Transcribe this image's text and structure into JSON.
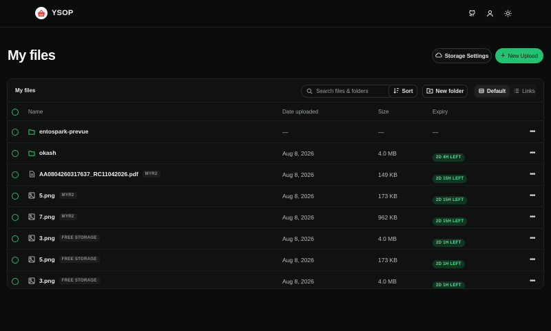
{
  "app": {
    "name": "YSOP"
  },
  "page": {
    "title": "My files"
  },
  "actions": {
    "storage_settings": "Storage Settings",
    "new_upload": "New Upload"
  },
  "panel": {
    "title": "My files",
    "search_placeholder": "Search files & folders",
    "sort_label": "Sort",
    "new_folder_label": "New folder",
    "view_default": "Default",
    "view_links": "Links"
  },
  "columns": {
    "name": "Name",
    "date": "Date uploaded",
    "size": "Size",
    "expiry": "Expiry"
  },
  "rows": [
    {
      "type": "folder",
      "name": "entospark-prevue",
      "tag": "",
      "date": "—",
      "size": "—",
      "expiry": "—"
    },
    {
      "type": "folder",
      "name": "okash",
      "tag": "",
      "date": "Aug 8, 2026",
      "size": "4.0 MB",
      "expiry": "2D 4H LEFT"
    },
    {
      "type": "document",
      "name": "AA0804260317637_RC11042026.pdf",
      "tag": "MYR2",
      "date": "Aug 8, 2026",
      "size": "149 KB",
      "expiry": "2D 15H LEFT"
    },
    {
      "type": "image",
      "name": "5.png",
      "tag": "MYR2",
      "date": "Aug 8, 2026",
      "size": "173 KB",
      "expiry": "2D 15H LEFT"
    },
    {
      "type": "image",
      "name": "7.png",
      "tag": "MYR2",
      "date": "Aug 8, 2026",
      "size": "962 KB",
      "expiry": "2D 15H LEFT"
    },
    {
      "type": "image",
      "name": "3.png",
      "tag": "FREE STORAGE",
      "date": "Aug 8, 2026",
      "size": "4.0 MB",
      "expiry": "2D 1H LEFT"
    },
    {
      "type": "image",
      "name": "5.png",
      "tag": "FREE STORAGE",
      "date": "Aug 8, 2026",
      "size": "173 KB",
      "expiry": "2D 1H LEFT"
    },
    {
      "type": "image",
      "name": "3.png",
      "tag": "FREE STORAGE",
      "date": "Aug 8, 2026",
      "size": "4.0 MB",
      "expiry": "2D 1H LEFT"
    }
  ],
  "colors": {
    "accent": "#21c372",
    "badge_text": "#54e39a",
    "badge_bg": "#123523",
    "background": "#0b0c0c"
  }
}
